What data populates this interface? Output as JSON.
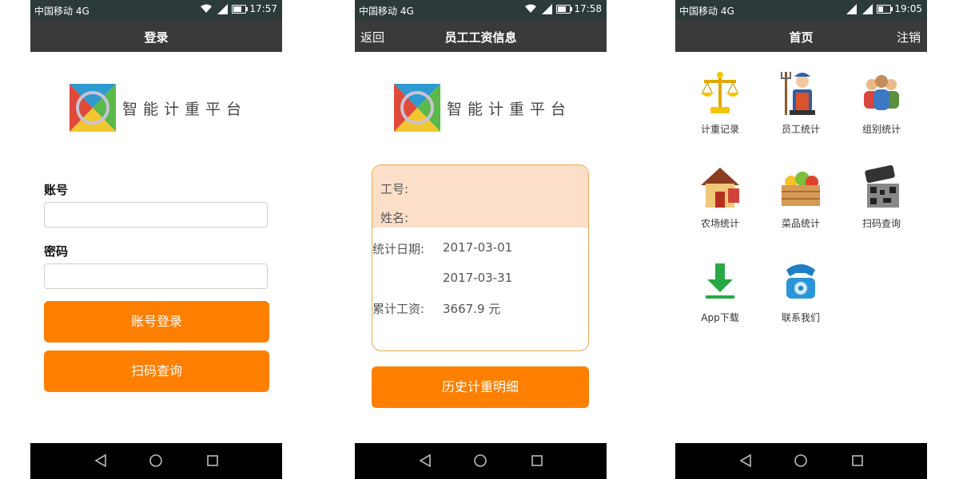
{
  "phones": [
    {
      "status": {
        "carrier": "中国移动 4G",
        "time": "17:57"
      },
      "title": "登录",
      "logo_text": "智能计重平台",
      "account_label": "账号",
      "password_label": "密码",
      "login_button": "账号登录",
      "scan_button": "扫码查询"
    },
    {
      "status": {
        "carrier": "中国移动 4G",
        "time": "17:58"
      },
      "back": "返回",
      "title": "员工工资信息",
      "logo_text": "智能计重平台",
      "card": {
        "id_label": "工号:",
        "name_label": "姓名:",
        "date_label": "统计日期:",
        "date_from": "2017-03-01",
        "date_to": "2017-03-31",
        "wage_label": "累计工资:",
        "wage_value": "3667.9 元"
      },
      "history_button": "历史计重明细"
    },
    {
      "status": {
        "carrier": "中国移动 4G",
        "time": "19:05"
      },
      "title": "首页",
      "logout": "注销",
      "grid": [
        "计重记录",
        "员工统计",
        "组别统计",
        "农场统计",
        "菜品统计",
        "扫码查询",
        "App下载",
        "联系我们"
      ]
    }
  ],
  "colors": {
    "accent": "#ff7f00",
    "titlebar": "#3a3a3a",
    "card_border": "#f0a850",
    "card_fill": "#fbdfc8"
  }
}
